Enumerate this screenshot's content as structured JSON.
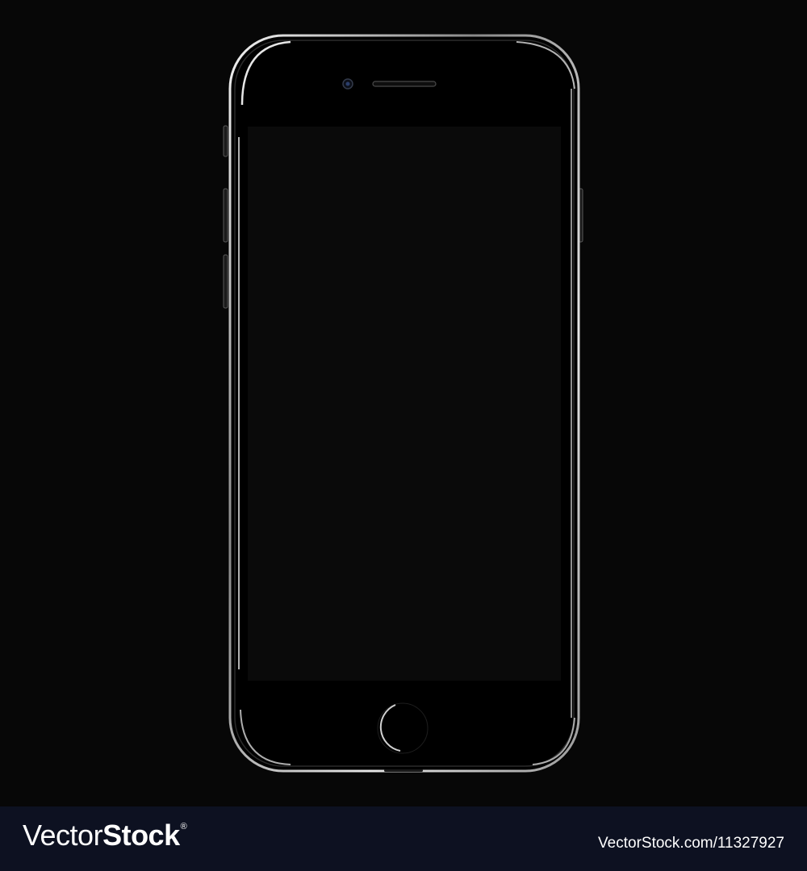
{
  "colors": {
    "background": "#070707",
    "phone_body": "#000000",
    "screen": "#0a0a0a",
    "bezel_highlight": "#d8d8d8",
    "camera_lens": "#2a3d6a",
    "footer_bar": "#0d1121",
    "footer_text": "#ffffff"
  },
  "device": {
    "name_icon": "smartphone-icon",
    "screen_state": "off",
    "camera_icon": "front-camera-icon",
    "speaker_icon": "earpiece-speaker-icon",
    "home_button_icon": "home-button-icon",
    "side_buttons": [
      "mute-switch-icon",
      "volume-up-icon",
      "volume-down-icon",
      "power-button-icon"
    ]
  },
  "footer": {
    "logo_part_a": "Vector",
    "logo_part_b": "Stock",
    "logo_mark": "®",
    "image_id": "VectorStock.com/11327927"
  }
}
